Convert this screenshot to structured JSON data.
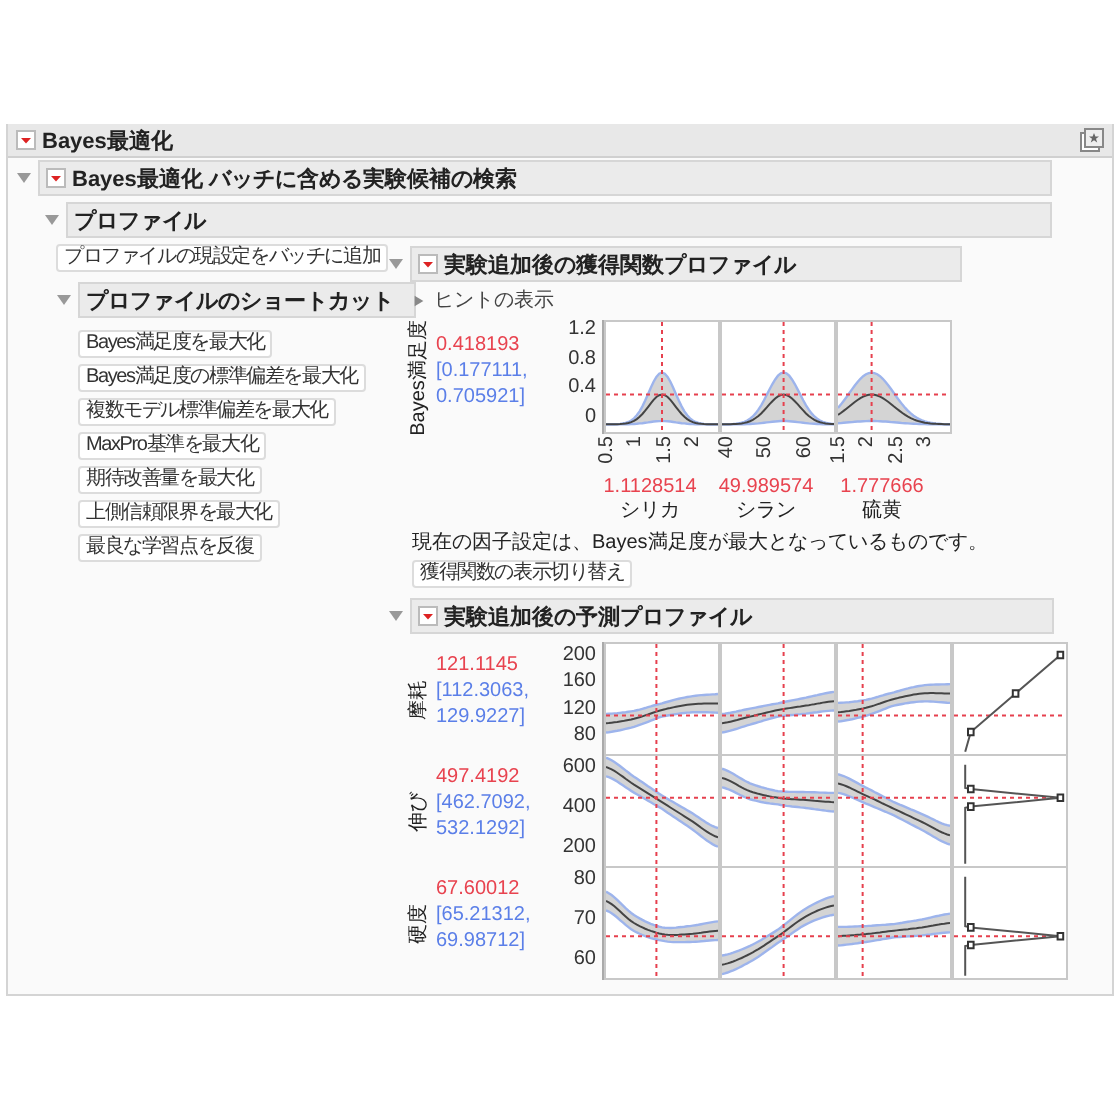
{
  "report": {
    "title": "Bayes最適化"
  },
  "section": {
    "title": "Bayes最適化 バッチに含める実験候補の検索",
    "expanded": true
  },
  "profile": {
    "title": "プロファイル",
    "expanded": true
  },
  "add_button": "プロファイルの現設定をバッチに追加",
  "shortcuts": {
    "title": "プロファイルのショートカット",
    "expanded": true,
    "buttons": [
      "Bayes満足度を最大化",
      "Bayes満足度の標準偏差を最大化",
      "複数モデル標準偏差を最大化",
      "MaxPro基準を最大化",
      "期待改善量を最大化",
      "上側信頼限界を最大化",
      "最良な学習点を反復"
    ]
  },
  "acquisition": {
    "title": "実験追加後の獲得関数プロファイル",
    "expanded": true,
    "hint": "ヒントの表示",
    "hint_expanded": false,
    "response": {
      "label": "Bayes満足度",
      "value": "0.418193",
      "interval": "[0.177111, 0.705921]"
    },
    "yticks": [
      "1.2",
      "0.8",
      "0.4",
      "0"
    ],
    "factors": [
      {
        "name": "シリカ",
        "value": "1.1128514",
        "ticks": [
          "0.5",
          "1",
          "1.5",
          "2"
        ]
      },
      {
        "name": "シラン",
        "value": "49.989574",
        "ticks": [
          "40",
          "50",
          "60"
        ]
      },
      {
        "name": "硫黄",
        "value": "1.777666",
        "ticks": [
          "1.5",
          "2",
          "2.5",
          "3"
        ]
      }
    ],
    "note": "現在の因子設定は、Bayes満足度が最大となっているものです。",
    "toggle_button": "獲得関数の表示切り替え"
  },
  "prediction": {
    "title": "実験追加後の予測プロファイル",
    "expanded": true,
    "responses": [
      {
        "label": "摩耗",
        "value": "121.1145",
        "interval": "[112.3063, 129.9227]",
        "yticks": [
          "200",
          "160",
          "120",
          "80"
        ]
      },
      {
        "label": "伸び",
        "value": "497.4192",
        "interval": "[462.7092, 532.1292]",
        "yticks": [
          "600",
          "400",
          "200"
        ]
      },
      {
        "label": "硬度",
        "value": "67.60012",
        "interval": "[65.21312, 69.98712]",
        "yticks": [
          "80",
          "70",
          "60"
        ]
      }
    ]
  }
}
